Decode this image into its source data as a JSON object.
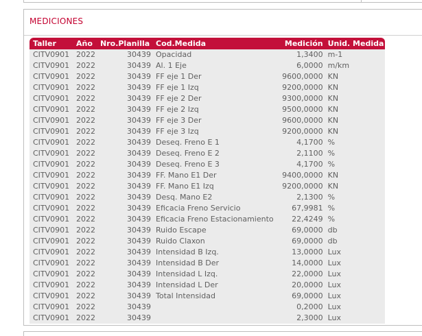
{
  "section": {
    "title": "MEDICIONES"
  },
  "table": {
    "headers": {
      "taller": "Taller",
      "anio": "Año",
      "planilla": "Nro.Planilla",
      "cod": "Cod.Medida",
      "medicion": "Medición",
      "unidad": "Unid. Medida"
    },
    "rows": [
      {
        "taller": "CITV0901",
        "anio": "2022",
        "planilla": "30439",
        "cod": "Opacidad",
        "medicion": "1,3400",
        "unidad": "m-1"
      },
      {
        "taller": "CITV0901",
        "anio": "2022",
        "planilla": "30439",
        "cod": "Al. 1 Eje",
        "medicion": "6,0000",
        "unidad": "m/km"
      },
      {
        "taller": "CITV0901",
        "anio": "2022",
        "planilla": "30439",
        "cod": "FF eje 1 Der",
        "medicion": "9600,0000",
        "unidad": "KN"
      },
      {
        "taller": "CITV0901",
        "anio": "2022",
        "planilla": "30439",
        "cod": "FF eje 1 Izq",
        "medicion": "9200,0000",
        "unidad": "KN"
      },
      {
        "taller": "CITV0901",
        "anio": "2022",
        "planilla": "30439",
        "cod": "FF eje 2 Der",
        "medicion": "9300,0000",
        "unidad": "KN"
      },
      {
        "taller": "CITV0901",
        "anio": "2022",
        "planilla": "30439",
        "cod": "FF eje 2 Izq",
        "medicion": "9500,0000",
        "unidad": "KN"
      },
      {
        "taller": "CITV0901",
        "anio": "2022",
        "planilla": "30439",
        "cod": "FF eje 3 Der",
        "medicion": "9600,0000",
        "unidad": "KN"
      },
      {
        "taller": "CITV0901",
        "anio": "2022",
        "planilla": "30439",
        "cod": "FF eje 3 Izq",
        "medicion": "9200,0000",
        "unidad": "KN"
      },
      {
        "taller": "CITV0901",
        "anio": "2022",
        "planilla": "30439",
        "cod": "Deseq. Freno E 1",
        "medicion": "4,1700",
        "unidad": "%"
      },
      {
        "taller": "CITV0901",
        "anio": "2022",
        "planilla": "30439",
        "cod": "Deseq. Freno E 2",
        "medicion": "2,1100",
        "unidad": "%"
      },
      {
        "taller": "CITV0901",
        "anio": "2022",
        "planilla": "30439",
        "cod": "Deseq. Freno E 3",
        "medicion": "4,1700",
        "unidad": "%"
      },
      {
        "taller": "CITV0901",
        "anio": "2022",
        "planilla": "30439",
        "cod": "FF. Mano E1 Der",
        "medicion": "9400,0000",
        "unidad": "KN"
      },
      {
        "taller": "CITV0901",
        "anio": "2022",
        "planilla": "30439",
        "cod": "FF. Mano E1 Izq",
        "medicion": "9200,0000",
        "unidad": "KN"
      },
      {
        "taller": "CITV0901",
        "anio": "2022",
        "planilla": "30439",
        "cod": "Desq. Mano E2",
        "medicion": "2,1300",
        "unidad": "%"
      },
      {
        "taller": "CITV0901",
        "anio": "2022",
        "planilla": "30439",
        "cod": "Eficacia Freno Servicio",
        "medicion": "67,9981",
        "unidad": "%"
      },
      {
        "taller": "CITV0901",
        "anio": "2022",
        "planilla": "30439",
        "cod": "Eficacia Freno Estacionamiento",
        "medicion": "22,4249",
        "unidad": "%"
      },
      {
        "taller": "CITV0901",
        "anio": "2022",
        "planilla": "30439",
        "cod": "Ruido Escape",
        "medicion": "69,0000",
        "unidad": "db"
      },
      {
        "taller": "CITV0901",
        "anio": "2022",
        "planilla": "30439",
        "cod": "Ruido Claxon",
        "medicion": "69,0000",
        "unidad": "db"
      },
      {
        "taller": "CITV0901",
        "anio": "2022",
        "planilla": "30439",
        "cod": "Intensidad B Izq.",
        "medicion": "13,0000",
        "unidad": "Lux"
      },
      {
        "taller": "CITV0901",
        "anio": "2022",
        "planilla": "30439",
        "cod": "Intensidad B Der",
        "medicion": "14,0000",
        "unidad": "Lux"
      },
      {
        "taller": "CITV0901",
        "anio": "2022",
        "planilla": "30439",
        "cod": "Intensidad L Izq.",
        "medicion": "22,0000",
        "unidad": "Lux"
      },
      {
        "taller": "CITV0901",
        "anio": "2022",
        "planilla": "30439",
        "cod": "Intensidad L Der",
        "medicion": "20,0000",
        "unidad": "Lux"
      },
      {
        "taller": "CITV0901",
        "anio": "2022",
        "planilla": "30439",
        "cod": "Total Intensidad",
        "medicion": "69,0000",
        "unidad": "Lux"
      },
      {
        "taller": "CITV0901",
        "anio": "2022",
        "planilla": "30439",
        "cod": "",
        "medicion": "0,2000",
        "unidad": "Lux"
      },
      {
        "taller": "CITV0901",
        "anio": "2022",
        "planilla": "30439",
        "cod": "",
        "medicion": "2,3000",
        "unidad": "Lux"
      }
    ]
  },
  "colors": {
    "accent": "#c3103a",
    "title": "#c3002f",
    "row_bg": "#ebebeb",
    "row_text": "#5f5f5f"
  }
}
